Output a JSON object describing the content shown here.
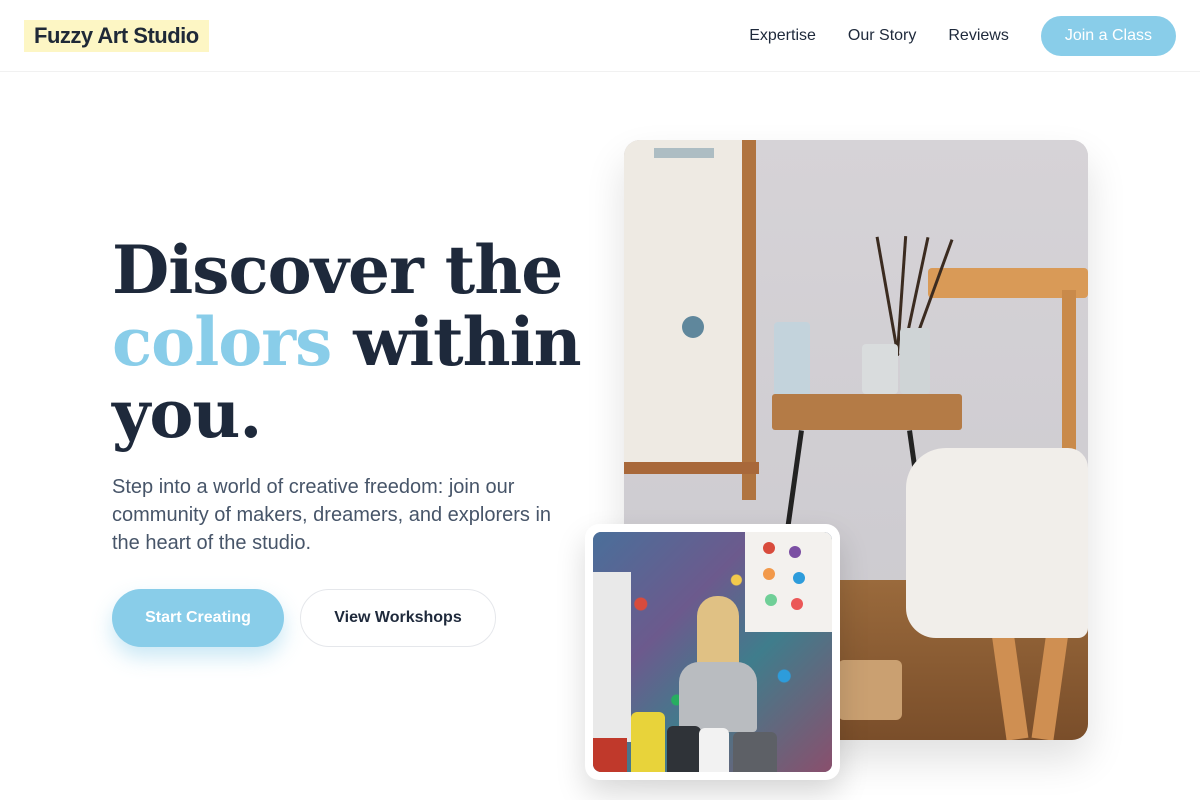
{
  "header": {
    "logo": "Fuzzy Art Studio",
    "nav": [
      {
        "label": "Expertise"
      },
      {
        "label": "Our Story"
      },
      {
        "label": "Reviews"
      }
    ],
    "cta_label": "Join a Class"
  },
  "hero": {
    "headline_line1": "Discover the",
    "headline_accent": "colors",
    "headline_line2_rest": "within",
    "headline_line3": "you.",
    "subtext": "Step into a world of creative freedom: join our community of makers, dreamers, and explorers in the heart of the studio.",
    "primary_button": "Start Creating",
    "secondary_button": "View Workshops"
  },
  "images": {
    "main": "studio-easel-table-photo",
    "inset": "child-painting-wall-photo"
  },
  "colors": {
    "accent": "#89cde9",
    "logo_highlight": "#fdf6c4",
    "text_dark": "#1e293b",
    "text_muted": "#475569"
  }
}
